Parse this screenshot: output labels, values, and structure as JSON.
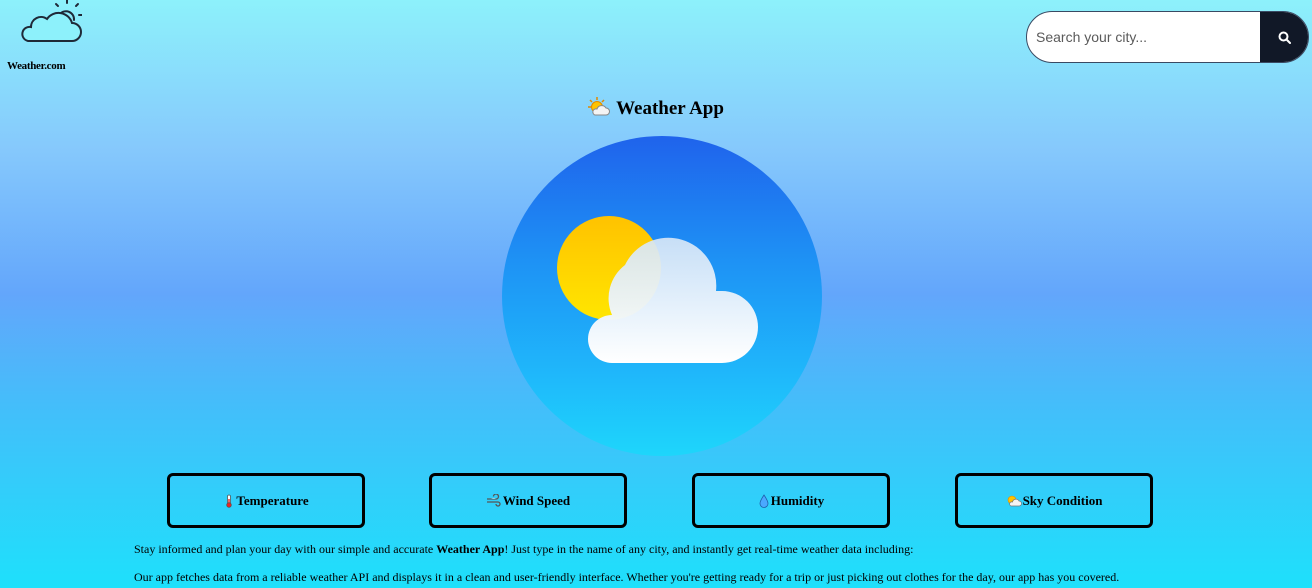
{
  "brand": {
    "name": "Weather.com",
    "logo_icon": "cloud-sun-icon"
  },
  "search": {
    "placeholder": "Search your city...",
    "value": "",
    "button_icon": "search-icon"
  },
  "header": {
    "title": "Weather App",
    "title_icon": "sun-behind-cloud-icon"
  },
  "hero": {
    "icon": "partly-cloudy-icon"
  },
  "features": [
    {
      "label": "Temperature",
      "icon": "thermometer-icon"
    },
    {
      "label": "Wind Speed",
      "icon": "wind-icon"
    },
    {
      "label": "Humidity",
      "icon": "droplet-icon"
    },
    {
      "label": "Sky Condition",
      "icon": "sun-behind-cloud-icon"
    }
  ],
  "description": {
    "line1_before": "Stay informed and plan your day with our simple and accurate ",
    "line1_bold": "Weather App",
    "line1_after": "! Just type in the name of any city, and instantly get real-time weather data including:",
    "line2": "Our app fetches data from a reliable weather API and displays it in a clean and user-friendly interface. Whether you're getting ready for a trip or just picking out clothes for the day, our app has you covered."
  },
  "colors": {
    "search_button": "#111827",
    "hero_top": "#1f63ec",
    "hero_bottom": "#1ed6fb",
    "sun": "#ffd400"
  }
}
